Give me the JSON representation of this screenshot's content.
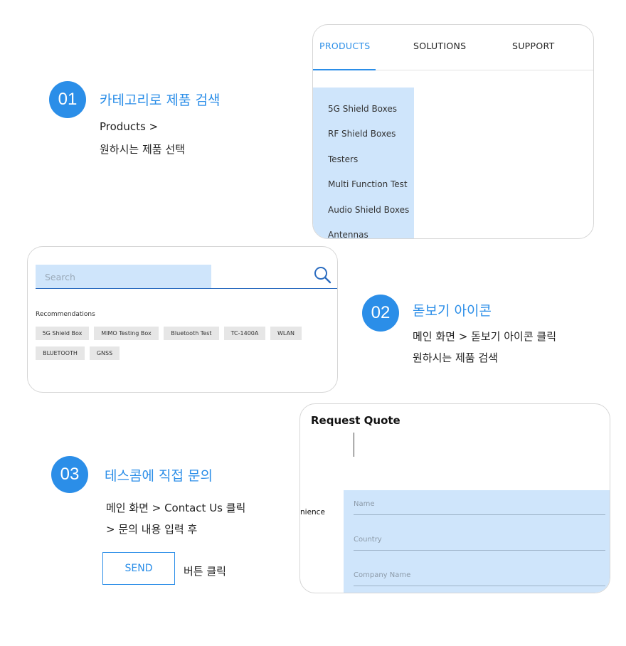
{
  "steps": [
    {
      "number": "01",
      "title": "카테고리로 제품 검색",
      "line1": "Products  >",
      "line2": "원하시는 제품 선택"
    },
    {
      "number": "02",
      "title": "돋보기 아이콘",
      "line1": "메인 화면 > 돋보기 아이콘 클릭",
      "line2": "원하시는 제품 검색"
    },
    {
      "number": "03",
      "title": "테스콤에 직접 문의",
      "line1": "메인 화면  > Contact Us 클릭",
      "line2": "> 문의 내용  입력 후",
      "send_label": "SEND",
      "after_send": "버튼 클릭"
    }
  ],
  "products_card": {
    "tabs": [
      "PRODUCTS",
      "SOLUTIONS",
      "SUPPORT"
    ],
    "active_tab": "PRODUCTS",
    "dropdown_items": [
      "5G Shield Boxes",
      "RF Shield Boxes",
      "Testers",
      "Multi Function Test",
      "Audio Shield Boxes",
      "Antennas"
    ]
  },
  "search_card": {
    "placeholder": "Search",
    "icon": "search-icon",
    "recommendations_label": "Recommendations",
    "tags": [
      "5G Shield Box",
      "MIMO Testing Box",
      "Bluetooth Test",
      "TC-1400A",
      "WLAN",
      "BLUETOOTH",
      "GNSS"
    ]
  },
  "quote_card": {
    "title": "Request Quote",
    "side_label": "nience",
    "fields": [
      "Name",
      "Country",
      "Company Name"
    ]
  },
  "colors": {
    "accent": "#2b8ee8",
    "highlight": "#cfe5fb"
  }
}
